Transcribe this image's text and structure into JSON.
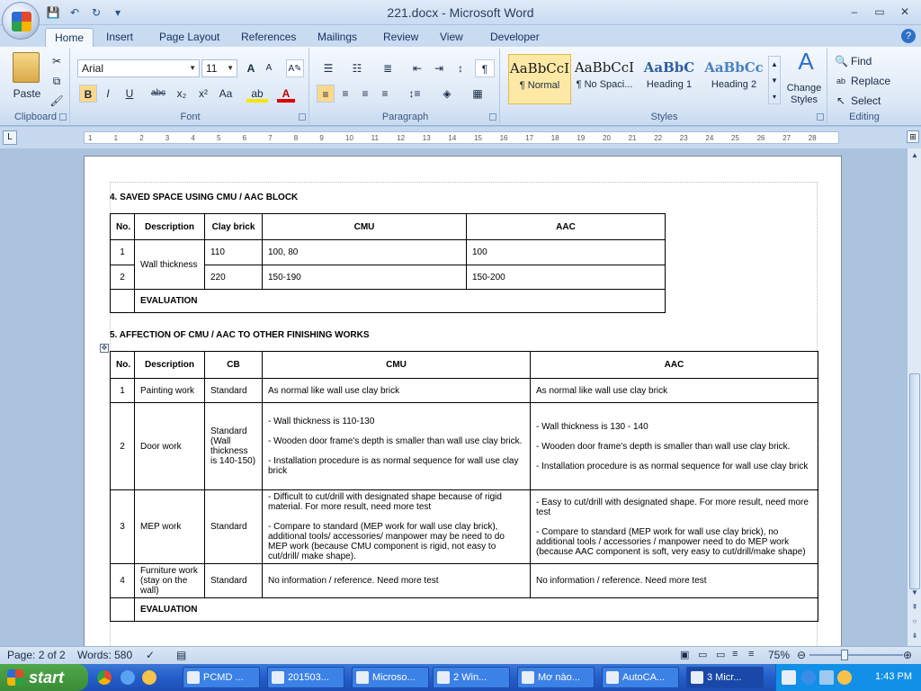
{
  "window": {
    "title": "221.docx - Microsoft Word",
    "minimize": "–",
    "restore": "▭",
    "close": "✕"
  },
  "qat": {
    "save": "💾",
    "undo": "↶",
    "redo": "↻",
    "customize": "▾"
  },
  "tabs": [
    "Home",
    "Insert",
    "Page Layout",
    "References",
    "Mailings",
    "Review",
    "View",
    "Developer"
  ],
  "active_tab": "Home",
  "ribbon": {
    "clipboard": {
      "label": "Clipboard",
      "paste": "Paste"
    },
    "font": {
      "label": "Font",
      "font_name": "Arial",
      "font_size": "11",
      "bold": "B",
      "italic": "I",
      "underline": "U",
      "strike": "abc",
      "subscript": "x₂",
      "superscript": "x²",
      "change_case": "Aa",
      "grow": "A",
      "shrink": "A"
    },
    "paragraph": {
      "label": "Paragraph",
      "pilcrow": "¶"
    },
    "styles": {
      "label": "Styles",
      "items": [
        {
          "sample": "AaBbCcI",
          "name": "¶ Normal"
        },
        {
          "sample": "AaBbCcI",
          "name": "¶ No Spaci..."
        },
        {
          "sample": "AaBbC",
          "name": "Heading 1"
        },
        {
          "sample": "AaBbCc",
          "name": "Heading 2"
        }
      ],
      "change_styles": "Change Styles"
    },
    "editing": {
      "label": "Editing",
      "find": "Find",
      "replace": "Replace",
      "select": "Select"
    }
  },
  "ruler": {
    "ticks": [
      "1",
      "1",
      "2",
      "3",
      "4",
      "5",
      "6",
      "7",
      "8",
      "9",
      "10",
      "11",
      "12",
      "13",
      "14",
      "15",
      "16",
      "17",
      "18",
      "19",
      "20",
      "21",
      "22",
      "23",
      "24",
      "25",
      "26",
      "27",
      "28"
    ]
  },
  "document": {
    "section4": {
      "heading": "4. SAVED SPACE USING CMU / AAC BLOCK",
      "headers": [
        "No.",
        "Description",
        "Clay brick",
        "CMU",
        "AAC"
      ],
      "rows": [
        {
          "no": "1",
          "clay": "110",
          "cmu": "100, 80",
          "aac": "100"
        },
        {
          "no": "2",
          "clay": "220",
          "cmu": "150-190",
          "aac": "150-200"
        }
      ],
      "merged_description": "Wall thickness",
      "evaluation": "EVALUATION"
    },
    "section5": {
      "heading": "5. AFFECTION OF CMU / AAC TO OTHER FINISHING WORKS",
      "headers": [
        "No.",
        "Description",
        "CB",
        "CMU",
        "AAC"
      ],
      "rows": [
        {
          "no": "1",
          "desc": "Painting work",
          "cb": "Standard",
          "cmu": [
            "As normal like wall use clay brick"
          ],
          "aac": [
            "As normal like wall use clay brick"
          ]
        },
        {
          "no": "2",
          "desc": "Door work",
          "cb": "Standard (Wall thickness is 140-150)",
          "cmu": [
            "- Wall thickness is 110-130",
            "- Wooden door frame's depth is smaller than wall use clay brick.",
            "- Installation procedure is as normal sequence for wall use clay brick"
          ],
          "aac": [
            "- Wall thickness is 130 - 140",
            "- Wooden door frame's depth is smaller than wall use clay brick.",
            "- Installation procedure is as normal sequence for wall use clay brick"
          ]
        },
        {
          "no": "3",
          "desc": "MEP work",
          "cb": "Standard",
          "cmu": [
            "- Difficult to cut/drill with designated shape because of rigid material. For more result, need more test",
            "- Compare to standard (MEP work for wall use clay brick), additional tools/ accessories/ manpower may be need to do MEP work (because CMU component is rigid, not easy to cut/drill/ make shape)."
          ],
          "aac": [
            "- Easy to cut/drill with designated shape. For more result, need more test",
            "- Compare to standard (MEP work for wall use clay brick), no additional tools / accessories / manpower need to do MEP work (because AAC component is soft, very easy to cut/drill/make shape)"
          ]
        },
        {
          "no": "4",
          "desc": "Furniture work (stay on the wall)",
          "cb": "Standard",
          "cmu": [
            "No information / reference. Need more test"
          ],
          "aac": [
            "No information / reference. Need more test"
          ]
        }
      ],
      "evaluation": "EVALUATION"
    }
  },
  "status": {
    "page": "Page: 2 of 2",
    "words": "Words: 580",
    "zoom": "75%"
  },
  "taskbar": {
    "start": "start",
    "tasks": [
      "PCMD ...",
      "201503...",
      "Microso...",
      "2 Win...",
      "Mơ nào...",
      "AutoCA...",
      "3 Micr..."
    ],
    "active_task": "3 Micr...",
    "clock": "1:43 PM"
  }
}
